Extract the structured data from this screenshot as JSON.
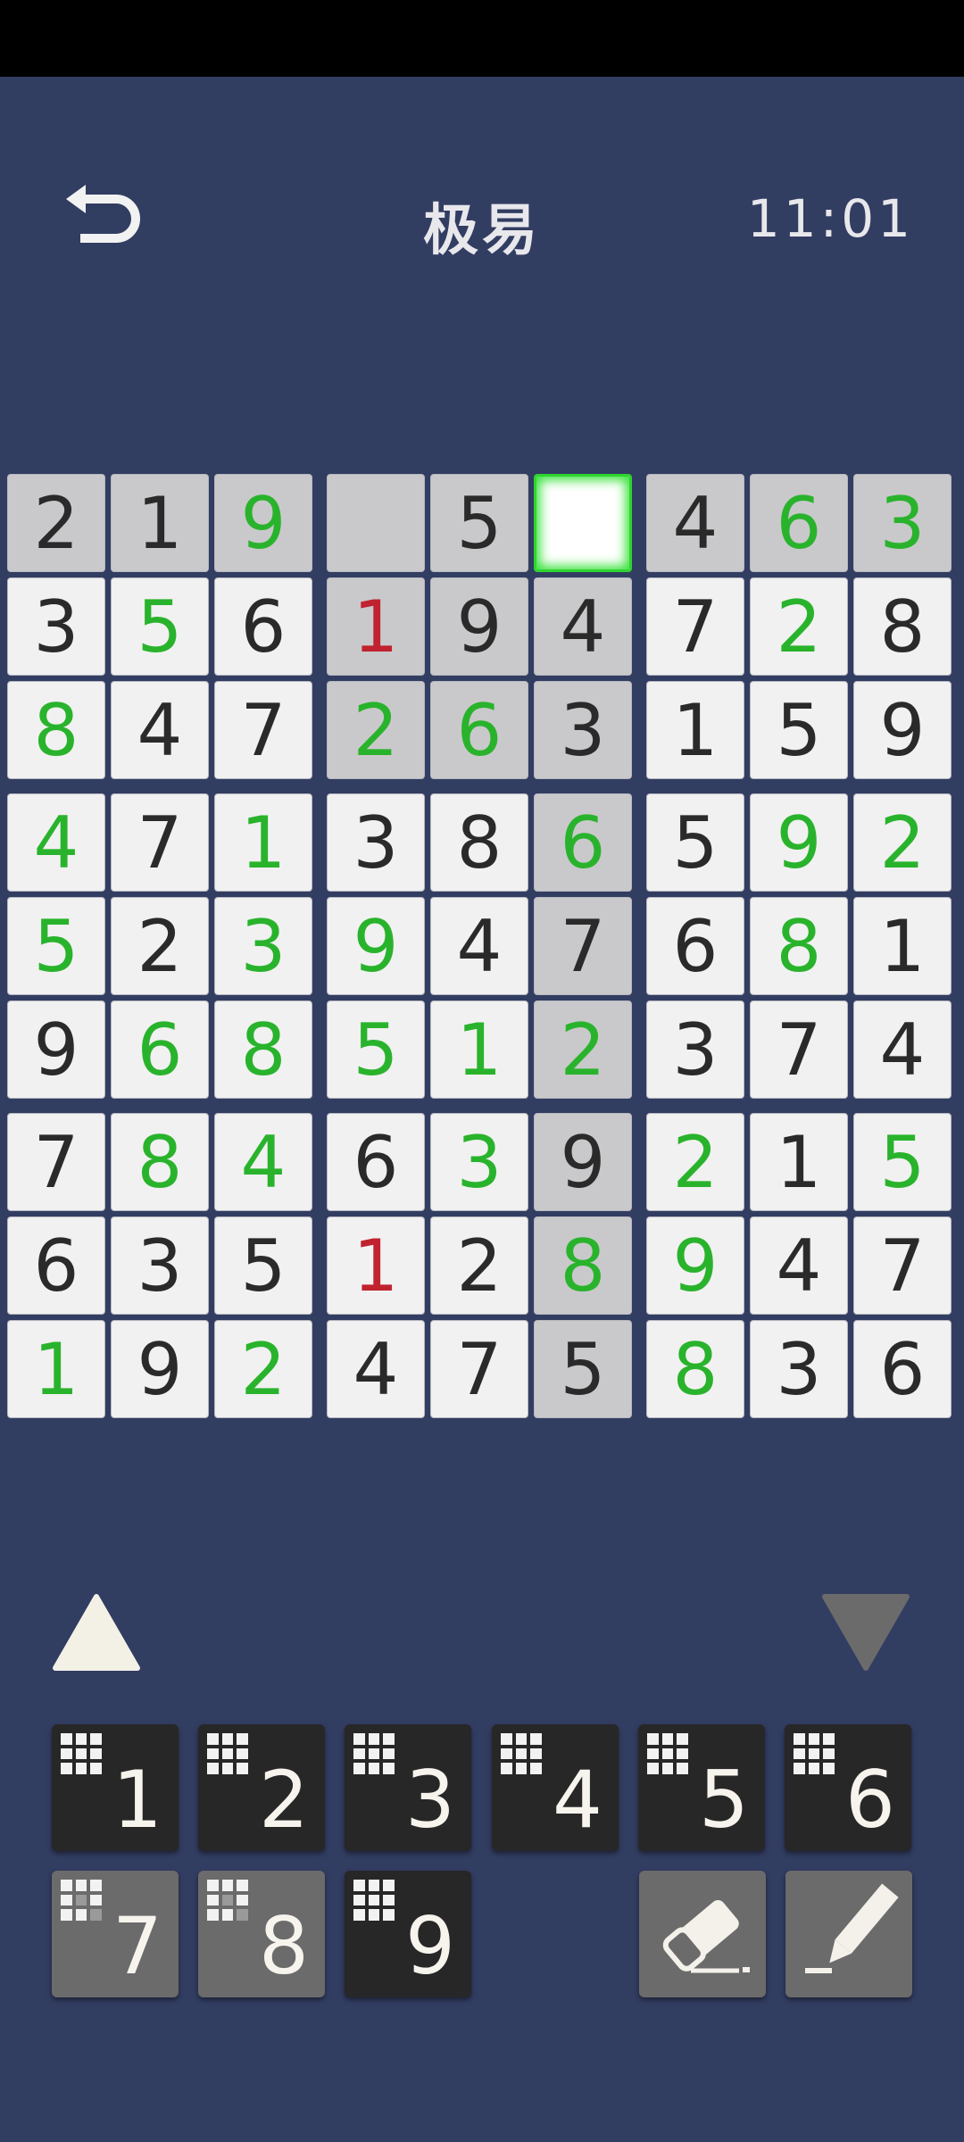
{
  "header": {
    "title": "极易",
    "time": "11:01"
  },
  "icons": {
    "back": "back-arrow-icon",
    "eraser": "eraser-icon",
    "pencil": "pencil-icon",
    "up": "triangle-up-icon",
    "down": "triangle-down-icon"
  },
  "colors": {
    "background": "#323d62",
    "given": "#2a2a2a",
    "entered": "#29b32c",
    "error": "#c0222f",
    "selected_border": "#2ed52f",
    "highlight": "#c9c9cb"
  },
  "board": {
    "rows": [
      [
        "2",
        "1",
        "9",
        "",
        "5",
        "",
        "4",
        "6",
        "3"
      ],
      [
        "3",
        "5",
        "6",
        "1",
        "9",
        "4",
        "7",
        "2",
        "8"
      ],
      [
        "8",
        "4",
        "7",
        "2",
        "6",
        "3",
        "1",
        "5",
        "9"
      ],
      [
        "4",
        "7",
        "1",
        "3",
        "8",
        "6",
        "5",
        "9",
        "2"
      ],
      [
        "5",
        "2",
        "3",
        "9",
        "4",
        "7",
        "6",
        "8",
        "1"
      ],
      [
        "9",
        "6",
        "8",
        "5",
        "1",
        "2",
        "3",
        "7",
        "4"
      ],
      [
        "7",
        "8",
        "4",
        "6",
        "3",
        "9",
        "2",
        "1",
        "5"
      ],
      [
        "6",
        "3",
        "5",
        "1",
        "2",
        "8",
        "9",
        "4",
        "7"
      ],
      [
        "1",
        "9",
        "2",
        "4",
        "7",
        "5",
        "8",
        "3",
        "6"
      ]
    ],
    "colors": [
      [
        "k",
        "k",
        "g",
        "k",
        "k",
        "k",
        "k",
        "g",
        "g"
      ],
      [
        "k",
        "g",
        "k",
        "r",
        "k",
        "k",
        "k",
        "g",
        "k"
      ],
      [
        "g",
        "k",
        "k",
        "g",
        "g",
        "k",
        "k",
        "k",
        "k"
      ],
      [
        "g",
        "k",
        "g",
        "k",
        "k",
        "g",
        "k",
        "g",
        "g"
      ],
      [
        "g",
        "k",
        "g",
        "g",
        "k",
        "k",
        "k",
        "g",
        "k"
      ],
      [
        "k",
        "g",
        "g",
        "g",
        "g",
        "g",
        "k",
        "k",
        "k"
      ],
      [
        "k",
        "g",
        "g",
        "k",
        "g",
        "k",
        "g",
        "k",
        "g"
      ],
      [
        "k",
        "k",
        "k",
        "r",
        "k",
        "g",
        "g",
        "k",
        "k"
      ],
      [
        "g",
        "k",
        "g",
        "k",
        "k",
        "k",
        "g",
        "k",
        "k"
      ]
    ],
    "selected": [
      0,
      5
    ]
  },
  "numpad": [
    {
      "label": "1",
      "done": false
    },
    {
      "label": "2",
      "done": false
    },
    {
      "label": "3",
      "done": false
    },
    {
      "label": "4",
      "done": false
    },
    {
      "label": "5",
      "done": false
    },
    {
      "label": "6",
      "done": false
    },
    {
      "label": "7",
      "done": true
    },
    {
      "label": "8",
      "done": true
    },
    {
      "label": "9",
      "done": false
    }
  ]
}
